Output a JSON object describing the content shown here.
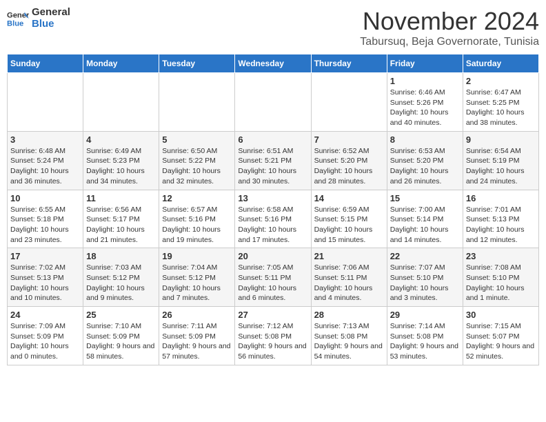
{
  "header": {
    "logo_line1": "General",
    "logo_line2": "Blue",
    "month": "November 2024",
    "location": "Tabursuq, Beja Governorate, Tunisia"
  },
  "weekdays": [
    "Sunday",
    "Monday",
    "Tuesday",
    "Wednesday",
    "Thursday",
    "Friday",
    "Saturday"
  ],
  "weeks": [
    [
      {
        "day": "",
        "info": ""
      },
      {
        "day": "",
        "info": ""
      },
      {
        "day": "",
        "info": ""
      },
      {
        "day": "",
        "info": ""
      },
      {
        "day": "",
        "info": ""
      },
      {
        "day": "1",
        "info": "Sunrise: 6:46 AM\nSunset: 5:26 PM\nDaylight: 10 hours and 40 minutes."
      },
      {
        "day": "2",
        "info": "Sunrise: 6:47 AM\nSunset: 5:25 PM\nDaylight: 10 hours and 38 minutes."
      }
    ],
    [
      {
        "day": "3",
        "info": "Sunrise: 6:48 AM\nSunset: 5:24 PM\nDaylight: 10 hours and 36 minutes."
      },
      {
        "day": "4",
        "info": "Sunrise: 6:49 AM\nSunset: 5:23 PM\nDaylight: 10 hours and 34 minutes."
      },
      {
        "day": "5",
        "info": "Sunrise: 6:50 AM\nSunset: 5:22 PM\nDaylight: 10 hours and 32 minutes."
      },
      {
        "day": "6",
        "info": "Sunrise: 6:51 AM\nSunset: 5:21 PM\nDaylight: 10 hours and 30 minutes."
      },
      {
        "day": "7",
        "info": "Sunrise: 6:52 AM\nSunset: 5:20 PM\nDaylight: 10 hours and 28 minutes."
      },
      {
        "day": "8",
        "info": "Sunrise: 6:53 AM\nSunset: 5:20 PM\nDaylight: 10 hours and 26 minutes."
      },
      {
        "day": "9",
        "info": "Sunrise: 6:54 AM\nSunset: 5:19 PM\nDaylight: 10 hours and 24 minutes."
      }
    ],
    [
      {
        "day": "10",
        "info": "Sunrise: 6:55 AM\nSunset: 5:18 PM\nDaylight: 10 hours and 23 minutes."
      },
      {
        "day": "11",
        "info": "Sunrise: 6:56 AM\nSunset: 5:17 PM\nDaylight: 10 hours and 21 minutes."
      },
      {
        "day": "12",
        "info": "Sunrise: 6:57 AM\nSunset: 5:16 PM\nDaylight: 10 hours and 19 minutes."
      },
      {
        "day": "13",
        "info": "Sunrise: 6:58 AM\nSunset: 5:16 PM\nDaylight: 10 hours and 17 minutes."
      },
      {
        "day": "14",
        "info": "Sunrise: 6:59 AM\nSunset: 5:15 PM\nDaylight: 10 hours and 15 minutes."
      },
      {
        "day": "15",
        "info": "Sunrise: 7:00 AM\nSunset: 5:14 PM\nDaylight: 10 hours and 14 minutes."
      },
      {
        "day": "16",
        "info": "Sunrise: 7:01 AM\nSunset: 5:13 PM\nDaylight: 10 hours and 12 minutes."
      }
    ],
    [
      {
        "day": "17",
        "info": "Sunrise: 7:02 AM\nSunset: 5:13 PM\nDaylight: 10 hours and 10 minutes."
      },
      {
        "day": "18",
        "info": "Sunrise: 7:03 AM\nSunset: 5:12 PM\nDaylight: 10 hours and 9 minutes."
      },
      {
        "day": "19",
        "info": "Sunrise: 7:04 AM\nSunset: 5:12 PM\nDaylight: 10 hours and 7 minutes."
      },
      {
        "day": "20",
        "info": "Sunrise: 7:05 AM\nSunset: 5:11 PM\nDaylight: 10 hours and 6 minutes."
      },
      {
        "day": "21",
        "info": "Sunrise: 7:06 AM\nSunset: 5:11 PM\nDaylight: 10 hours and 4 minutes."
      },
      {
        "day": "22",
        "info": "Sunrise: 7:07 AM\nSunset: 5:10 PM\nDaylight: 10 hours and 3 minutes."
      },
      {
        "day": "23",
        "info": "Sunrise: 7:08 AM\nSunset: 5:10 PM\nDaylight: 10 hours and 1 minute."
      }
    ],
    [
      {
        "day": "24",
        "info": "Sunrise: 7:09 AM\nSunset: 5:09 PM\nDaylight: 10 hours and 0 minutes."
      },
      {
        "day": "25",
        "info": "Sunrise: 7:10 AM\nSunset: 5:09 PM\nDaylight: 9 hours and 58 minutes."
      },
      {
        "day": "26",
        "info": "Sunrise: 7:11 AM\nSunset: 5:09 PM\nDaylight: 9 hours and 57 minutes."
      },
      {
        "day": "27",
        "info": "Sunrise: 7:12 AM\nSunset: 5:08 PM\nDaylight: 9 hours and 56 minutes."
      },
      {
        "day": "28",
        "info": "Sunrise: 7:13 AM\nSunset: 5:08 PM\nDaylight: 9 hours and 54 minutes."
      },
      {
        "day": "29",
        "info": "Sunrise: 7:14 AM\nSunset: 5:08 PM\nDaylight: 9 hours and 53 minutes."
      },
      {
        "day": "30",
        "info": "Sunrise: 7:15 AM\nSunset: 5:07 PM\nDaylight: 9 hours and 52 minutes."
      }
    ]
  ]
}
